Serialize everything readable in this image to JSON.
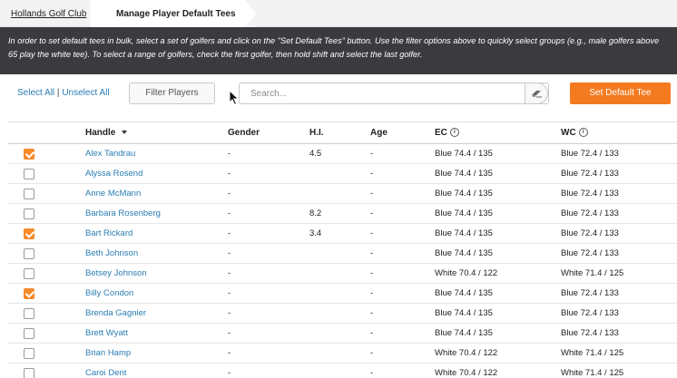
{
  "breadcrumb": {
    "home": "Hollands Golf Club",
    "current": "Manage Player Default Tees"
  },
  "banner": {
    "text": "In order to set default tees in bulk, select a set of golfers and click on the \"Set Default Tees\" button. Use the filter options above to quickly select groups (e.g., male golfers above 65 play the white tee). To select a range of golfers, check the first golfer, then hold shift and select the last golfer."
  },
  "toolbar": {
    "select_all": "Select All",
    "separator": "|",
    "unselect_all": "Unselect All",
    "filter_label": "Filter Players",
    "search_placeholder": "Search...",
    "set_default_label": "Set Default Tee"
  },
  "table": {
    "headers": {
      "handle": "Handle",
      "gender": "Gender",
      "hi": "H.I.",
      "age": "Age",
      "ec": "EC",
      "wc": "WC"
    },
    "rows": [
      {
        "checked": true,
        "handle": "Alex Tandrau",
        "gender": "-",
        "hi": "4.5",
        "age": "-",
        "ec": "Blue 74.4 / 135",
        "wc": "Blue 72.4 / 133"
      },
      {
        "checked": false,
        "handle": "Alyssa Rosend",
        "gender": "-",
        "hi": "",
        "age": "-",
        "ec": "Blue 74.4 / 135",
        "wc": "Blue 72.4 / 133"
      },
      {
        "checked": false,
        "handle": "Anne McMann",
        "gender": "-",
        "hi": "",
        "age": "-",
        "ec": "Blue 74.4 / 135",
        "wc": "Blue 72.4 / 133"
      },
      {
        "checked": false,
        "handle": "Barbara Rosenberg",
        "gender": "-",
        "hi": "8.2",
        "age": "-",
        "ec": "Blue 74.4 / 135",
        "wc": "Blue 72.4 / 133"
      },
      {
        "checked": true,
        "handle": "Bart Rickard",
        "gender": "-",
        "hi": "3.4",
        "age": "-",
        "ec": "Blue 74.4 / 135",
        "wc": "Blue 72.4 / 133"
      },
      {
        "checked": false,
        "handle": "Beth Johnson",
        "gender": "-",
        "hi": "",
        "age": "-",
        "ec": "Blue 74.4 / 135",
        "wc": "Blue 72.4 / 133"
      },
      {
        "checked": false,
        "handle": "Betsey Johnson",
        "gender": "-",
        "hi": "",
        "age": "-",
        "ec": "White 70.4 / 122",
        "wc": "White 71.4 / 125"
      },
      {
        "checked": true,
        "handle": "Billy Condon",
        "gender": "-",
        "hi": "",
        "age": "-",
        "ec": "Blue 74.4 / 135",
        "wc": "Blue 72.4 / 133"
      },
      {
        "checked": false,
        "handle": "Brenda Gagnier",
        "gender": "-",
        "hi": "",
        "age": "-",
        "ec": "Blue 74.4 / 135",
        "wc": "Blue 72.4 / 133"
      },
      {
        "checked": false,
        "handle": "Brett Wyatt",
        "gender": "-",
        "hi": "",
        "age": "-",
        "ec": "Blue 74.4 / 135",
        "wc": "Blue 72.4 / 133"
      },
      {
        "checked": false,
        "handle": "Brian Hamp",
        "gender": "-",
        "hi": "",
        "age": "-",
        "ec": "White 70.4 / 122",
        "wc": "White 71.4 / 125"
      },
      {
        "checked": false,
        "handle": "Caroi Dent",
        "gender": "-",
        "hi": "",
        "age": "-",
        "ec": "White 70.4 / 122",
        "wc": "White 71.4 / 125"
      }
    ]
  },
  "colors": {
    "accent": "#f47a20",
    "link": "#2a7db3",
    "banner_bg": "#3b3b3f"
  }
}
